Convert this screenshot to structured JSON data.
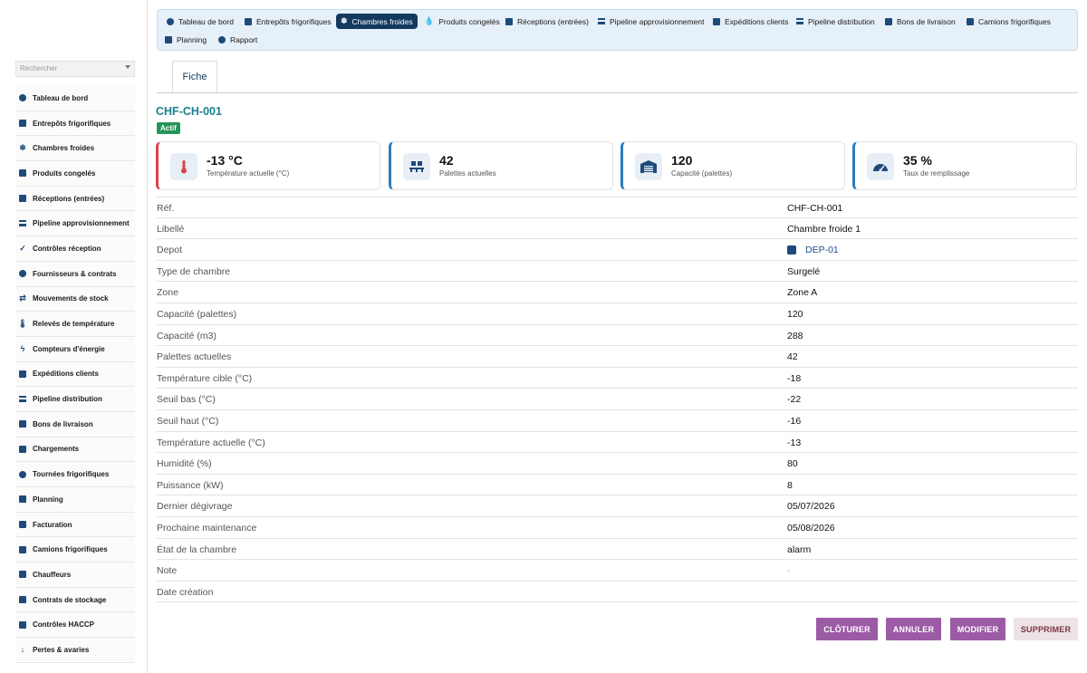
{
  "sidebar": {
    "search_placeholder": "Rechercher",
    "items": [
      {
        "label": "Tableau de bord",
        "icon": "dashboard-icon"
      },
      {
        "label": "Entrepôts frigorifiques",
        "icon": "warehouse-icon"
      },
      {
        "label": "Chambres froides",
        "icon": "snowflake-icon"
      },
      {
        "label": "Produits congelés",
        "icon": "box-icon"
      },
      {
        "label": "Réceptions (entrées)",
        "icon": "dolly-icon"
      },
      {
        "label": "Pipeline approvisionnement",
        "icon": "bars-icon"
      },
      {
        "label": "Contrôles réception",
        "icon": "checklist-icon"
      },
      {
        "label": "Fournisseurs & contrats",
        "icon": "handshake-icon"
      },
      {
        "label": "Mouvements de stock",
        "icon": "exchange-icon"
      },
      {
        "label": "Relevés de température",
        "icon": "thermometer-icon"
      },
      {
        "label": "Compteurs d'énergie",
        "icon": "bolt-icon"
      },
      {
        "label": "Expéditions clients",
        "icon": "document-icon"
      },
      {
        "label": "Pipeline distribution",
        "icon": "bars-icon"
      },
      {
        "label": "Bons de livraison",
        "icon": "truck-icon"
      },
      {
        "label": "Chargements",
        "icon": "dolly-icon"
      },
      {
        "label": "Tournées frigorifiques",
        "icon": "route-icon"
      },
      {
        "label": "Planning",
        "icon": "calendar-icon"
      },
      {
        "label": "Facturation",
        "icon": "invoice-icon"
      },
      {
        "label": "Camions frigorifiques",
        "icon": "truck-icon"
      },
      {
        "label": "Chauffeurs",
        "icon": "id-card-icon"
      },
      {
        "label": "Contrats de stockage",
        "icon": "contract-icon"
      },
      {
        "label": "Contrôles HACCP",
        "icon": "clipboard-icon"
      },
      {
        "label": "Pertes & avaries",
        "icon": "arrow-down-icon"
      }
    ]
  },
  "topnav": {
    "tabs": [
      {
        "label": "Tableau de bord",
        "icon": "dashboard-icon",
        "active": false
      },
      {
        "label": "Entrepôts frigorifiques",
        "icon": "warehouse-icon",
        "active": false
      },
      {
        "label": "Chambres froides",
        "icon": "snowflake-icon",
        "active": true
      },
      {
        "label": "Produits congelés",
        "icon": "drop-icon",
        "active": false
      },
      {
        "label": "Réceptions (entrées)",
        "icon": "dolly-icon",
        "active": false
      },
      {
        "label": "Pipeline approvisionnement",
        "icon": "bars-icon",
        "active": false
      },
      {
        "label": "Expéditions clients",
        "icon": "document-icon",
        "active": false
      },
      {
        "label": "Pipeline distribution",
        "icon": "bars-icon",
        "active": false
      },
      {
        "label": "Bons de livraison",
        "icon": "truck-icon",
        "active": false
      },
      {
        "label": "Camions frigorifiques",
        "icon": "truck-icon",
        "active": false
      },
      {
        "label": "Planning",
        "icon": "calendar-icon",
        "active": false
      },
      {
        "label": "Rapport",
        "icon": "chart-pie-icon",
        "active": false
      }
    ]
  },
  "record": {
    "tab_label": "Fiche",
    "title": "CHF-CH-001",
    "status_badge": "Actif"
  },
  "kpis": [
    {
      "value": "-13 °C",
      "caption": "Température actuelle (°C)",
      "icon": "thermometer-icon",
      "accent": "#d9434f"
    },
    {
      "value": "42",
      "caption": "Palettes actuelles",
      "icon": "pallet-icon",
      "accent": "#2f7bb8"
    },
    {
      "value": "120",
      "caption": "Capacité (palettes)",
      "icon": "warehouse-icon",
      "accent": "#2f7bb8"
    },
    {
      "value": "35 %",
      "caption": "Taux de remplissage",
      "icon": "gauge-icon",
      "accent": "#2f7bb8"
    }
  ],
  "fields": [
    {
      "label": "Réf.",
      "value": "CHF-CH-001"
    },
    {
      "label": "Libellé",
      "value": "Chambre froide 1"
    },
    {
      "label": "Depot",
      "value": "DEP-01"
    },
    {
      "label": "Type de chambre",
      "value": "Surgelé"
    },
    {
      "label": "Zone",
      "value": "Zone A"
    },
    {
      "label": "Capacité (palettes)",
      "value": "120"
    },
    {
      "label": "Capacité (m3)",
      "value": "288"
    },
    {
      "label": "Palettes actuelles",
      "value": "42"
    },
    {
      "label": "Température cible (°C)",
      "value": "-18"
    },
    {
      "label": "Seuil bas (°C)",
      "value": "-22"
    },
    {
      "label": "Seuil haut (°C)",
      "value": "-16"
    },
    {
      "label": "Température actuelle (°C)",
      "value": "-13"
    },
    {
      "label": "Humidité (%)",
      "value": "80"
    },
    {
      "label": "Puissance (kW)",
      "value": "8"
    },
    {
      "label": "Dernier dégivrage",
      "value": "05/07/2026"
    },
    {
      "label": "Prochaine maintenance",
      "value": "05/08/2026"
    },
    {
      "label": "État de la chambre",
      "value": "alarm"
    },
    {
      "label": "Note",
      "value": "-"
    },
    {
      "label": "Date création",
      "value": ""
    }
  ],
  "actions": {
    "close": "CLÔTURER",
    "cancel": "ANNULER",
    "edit": "MODIFIER",
    "delete": "SUPPRIMER"
  },
  "colors": {
    "accent": "#123a5e",
    "title": "#1b7f8c",
    "status": "#24955a",
    "action": "#9c5ba5"
  }
}
